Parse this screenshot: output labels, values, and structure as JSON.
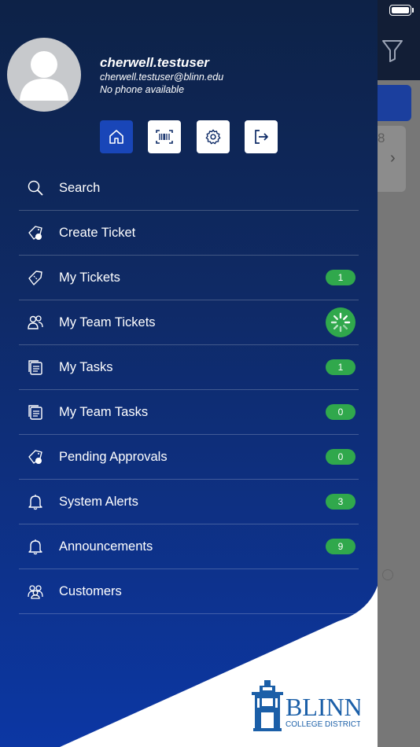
{
  "user": {
    "name": "cherwell.testuser",
    "email": "cherwell.testuser@blinn.edu",
    "phone": "No phone available"
  },
  "quick_actions": [
    {
      "icon": "home-icon",
      "active": true
    },
    {
      "icon": "barcode-icon",
      "active": false
    },
    {
      "icon": "gear-icon",
      "active": false
    },
    {
      "icon": "logout-icon",
      "active": false
    }
  ],
  "menu": {
    "items": [
      {
        "label": "Search",
        "icon": "search-icon"
      },
      {
        "label": "Create Ticket",
        "icon": "create-ticket-icon"
      },
      {
        "label": "My Tickets",
        "icon": "ticket-icon",
        "badge": "1"
      },
      {
        "label": "My Team Tickets",
        "icon": "team-icon",
        "badge_state": "loading"
      },
      {
        "label": "My Tasks",
        "icon": "tasks-icon",
        "badge": "1"
      },
      {
        "label": "My Team Tasks",
        "icon": "team-tasks-icon",
        "badge": "0"
      },
      {
        "label": "Pending Approvals",
        "icon": "approvals-icon",
        "badge": "0"
      },
      {
        "label": "System Alerts",
        "icon": "bell-icon",
        "badge": "3"
      },
      {
        "label": "Announcements",
        "icon": "bell-icon",
        "badge": "9"
      },
      {
        "label": "Customers",
        "icon": "customers-icon"
      }
    ]
  },
  "logo": {
    "name": "BLINN",
    "subtitle": "COLLEGE DISTRICT",
    "color": "#1b5fa8"
  },
  "background": {
    "card_number": "8"
  },
  "colors": {
    "drawer_top": "#0d2247",
    "drawer_bottom": "#0c37a4",
    "badge": "#30a84c",
    "active_button": "#1946b8"
  }
}
